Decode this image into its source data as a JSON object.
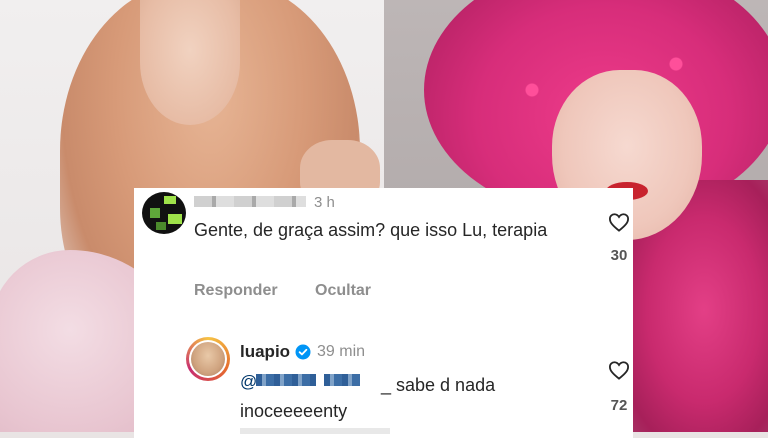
{
  "top_comment": {
    "time": "3 h",
    "text": "Gente, de graça assim? que isso Lu, terapia",
    "likes": "30",
    "actions": {
      "reply_label": "Responder",
      "hide_label": "Ocultar"
    }
  },
  "reply_comment": {
    "username": "luapio",
    "verified": true,
    "time": "39 min",
    "mention_prefix": "@",
    "text": "_ sabe d nada inoceeeeenty",
    "likes": "72"
  },
  "colors": {
    "verified_blue": "#0095f6",
    "text_primary": "#262626",
    "text_secondary": "#8e8e8e",
    "mention_blue": "#00376b"
  },
  "icons": {
    "like": "heart-outline-icon",
    "verified": "verified-badge-icon"
  }
}
